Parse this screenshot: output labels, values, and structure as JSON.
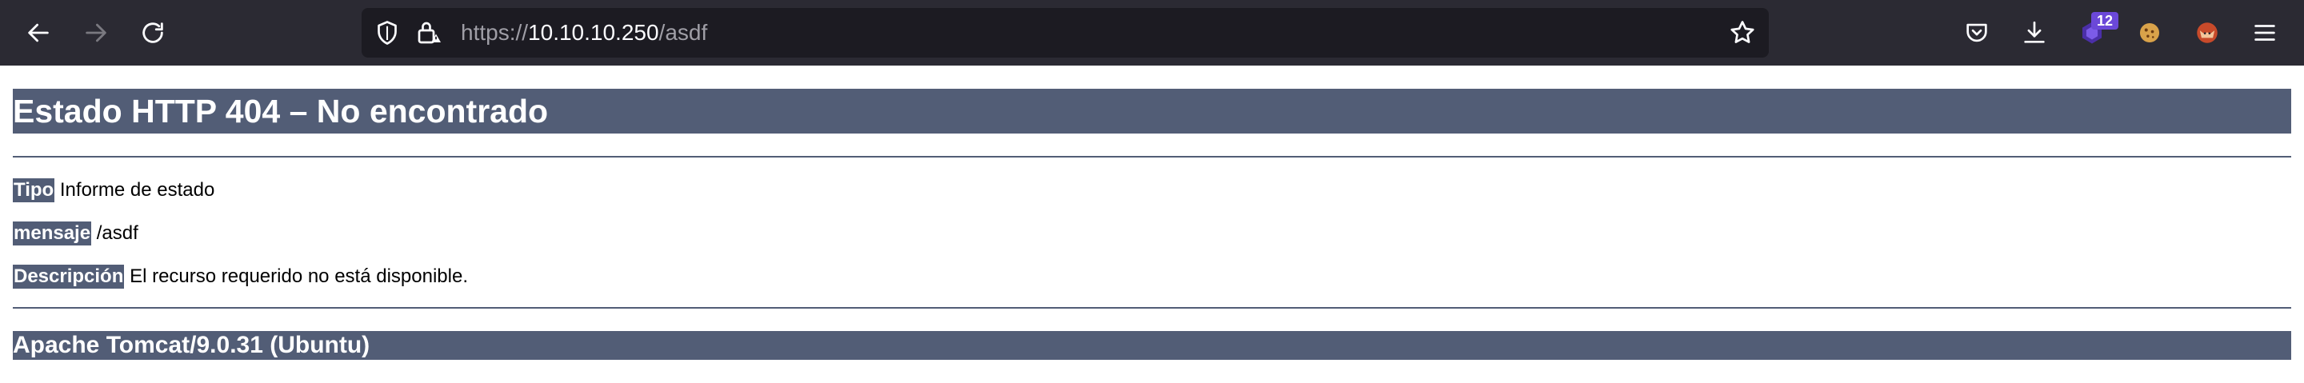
{
  "browser": {
    "url": {
      "scheme": "https://",
      "host": "10.10.10.250",
      "path": "/asdf"
    },
    "extension_badge": "12",
    "icons": {
      "back": "back-arrow-icon",
      "forward": "forward-arrow-icon",
      "reload": "reload-icon",
      "tracking": "shield-icon",
      "insecure": "insecure-lock-icon",
      "bookmark": "star-icon",
      "pocket": "pocket-icon",
      "downloads": "download-icon",
      "extension1": "ublock-icon",
      "extension2": "cookie-icon",
      "extension3": "fox-extension-icon",
      "menu": "hamburger-menu-icon"
    },
    "colors": {
      "toolbar": "#2b2a33",
      "urlbar": "#1c1b22",
      "badge": "#6b48d8"
    }
  },
  "page": {
    "title": "Estado HTTP 404 – No encontrado",
    "type_label": "Tipo",
    "type_value": "Informe de estado",
    "message_label": "mensaje",
    "message_value": "/asdf",
    "description_label": "Descripción",
    "description_value": "El recurso requerido no está disponible.",
    "footer": "Apache Tomcat/9.0.31 (Ubuntu)",
    "colors": {
      "header_bg": "#525d76",
      "header_text": "#ffffff"
    }
  }
}
